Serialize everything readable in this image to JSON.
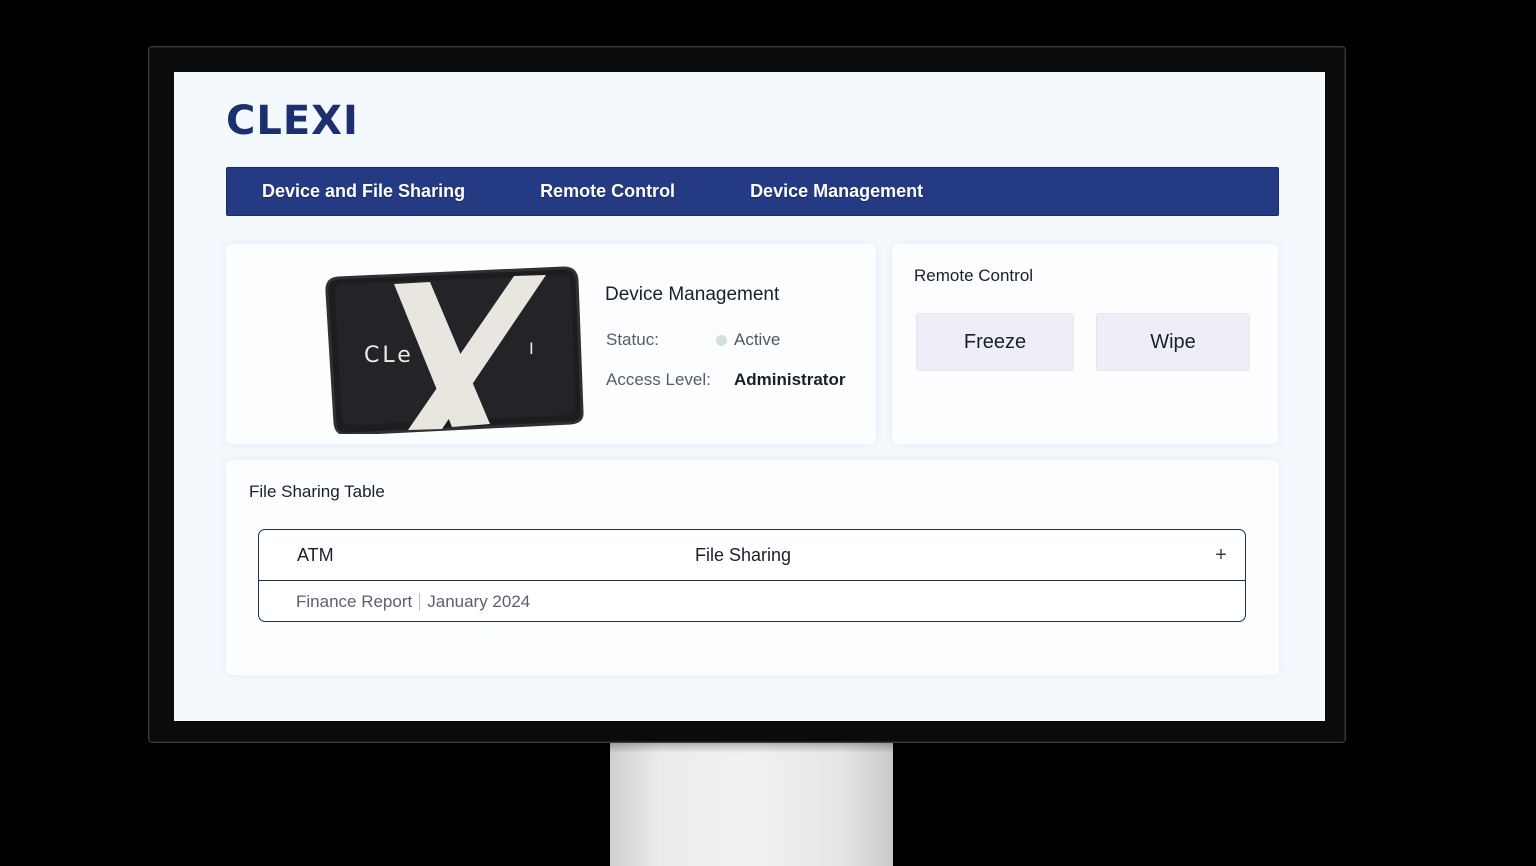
{
  "app": {
    "logo": "CLEXI"
  },
  "nav": {
    "items": [
      {
        "label": "Device and File Sharing"
      },
      {
        "label": "Remote Control"
      },
      {
        "label": "Device Management"
      }
    ]
  },
  "device": {
    "title": "Device Management",
    "image_text": {
      "left": "CLe",
      "right": "I"
    },
    "status_label": "Statuc:",
    "status_value": "Active",
    "status_color": "#cfe2dc",
    "access_label": "Access Level:",
    "access_value": "Administrator"
  },
  "remote": {
    "title": "Remote Control",
    "freeze_label": "Freeze",
    "wipe_label": "Wipe"
  },
  "files": {
    "title": "File Sharing Table",
    "columns": [
      "ATM",
      "File Sharing"
    ],
    "add_label": "+",
    "rows": [
      {
        "name": "Finance Report",
        "date": "January 2024"
      }
    ]
  },
  "colors": {
    "brand": "#1c2f6e",
    "nav_background": "#243a82",
    "screen_background": "#f3f9fd"
  }
}
